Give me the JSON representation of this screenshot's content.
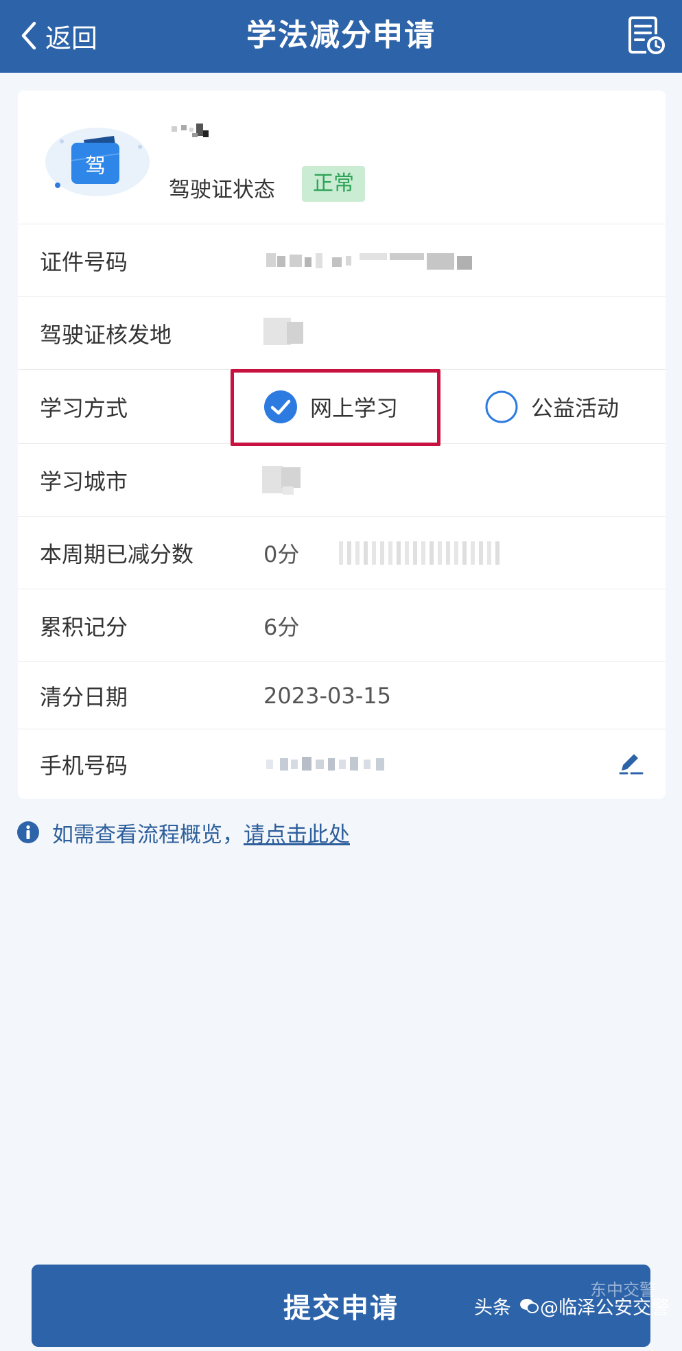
{
  "header": {
    "back_label": "返回",
    "title": "学法减分申请"
  },
  "profile": {
    "license_char": "驾",
    "status_label": "驾驶证状态",
    "status_value": "正常"
  },
  "rows": {
    "id_number": {
      "label": "证件号码"
    },
    "issue_place": {
      "label": "驾驶证核发地"
    },
    "study_method": {
      "label": "学习方式",
      "options": [
        {
          "label": "网上学习",
          "selected": true
        },
        {
          "label": "公益活动",
          "selected": false
        }
      ]
    },
    "study_city": {
      "label": "学习城市"
    },
    "deducted": {
      "label": "本周期已减分数",
      "value": "0分"
    },
    "accumulated": {
      "label": "累积记分",
      "value": "6分"
    },
    "clear_date": {
      "label": "清分日期",
      "value": "2023-03-15"
    },
    "phone": {
      "label": "手机号码"
    }
  },
  "hint": {
    "text": "如需查看流程概览，",
    "link": "请点击此处"
  },
  "submit_label": "提交申请",
  "watermark": {
    "prefix": "头条",
    "account": "@临泽公安交警",
    "faint": "东中交警"
  },
  "colors": {
    "brand": "#2d63a8",
    "status_bg": "#c9ecd2",
    "status_text": "#2ea357",
    "highlight": "#c7113f",
    "hint": "#2d5f9c"
  },
  "icons": {
    "back": "chevron-left-icon",
    "record": "document-clock-icon",
    "checked": "check-circle-icon",
    "unchecked": "circle-icon",
    "edit": "pen-icon",
    "info": "info-icon"
  }
}
